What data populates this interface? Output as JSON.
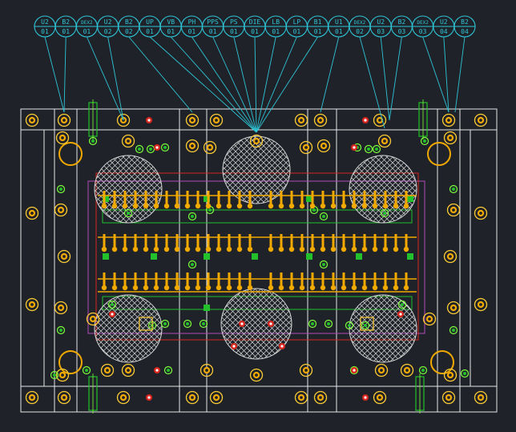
{
  "cad": {
    "background_color": "#1f2329",
    "colors": {
      "outline": "#e6e6e6",
      "leader": "#2ec4d6",
      "balloon_text": "#2ec4d6",
      "copper": "#f2a900",
      "copper_ring": "#ffcc33",
      "green_part": "#22c02a",
      "green_ring": "#7cff3a",
      "red_part": "#d8261e",
      "purple_line": "#b04ab8",
      "hatch": "#d6d6d6"
    },
    "balloons": [
      {
        "top": "U2",
        "bottom": "01"
      },
      {
        "top": "B2",
        "bottom": "01"
      },
      {
        "top": "DEX2",
        "bottom": "01"
      },
      {
        "top": "U2",
        "bottom": "02"
      },
      {
        "top": "B2",
        "bottom": "02"
      },
      {
        "top": "UP",
        "bottom": "01"
      },
      {
        "top": "VB",
        "bottom": "01"
      },
      {
        "top": "PH",
        "bottom": "01"
      },
      {
        "top": "PPS",
        "bottom": "01"
      },
      {
        "top": "PS",
        "bottom": "01"
      },
      {
        "top": "DIE",
        "bottom": "01"
      },
      {
        "top": "LB",
        "bottom": "01"
      },
      {
        "top": "LP",
        "bottom": "01"
      },
      {
        "top": "B1",
        "bottom": "01"
      },
      {
        "top": "U1",
        "bottom": "01"
      },
      {
        "top": "DEX2",
        "bottom": "02"
      },
      {
        "top": "U2",
        "bottom": "03"
      },
      {
        "top": "B2",
        "bottom": "03"
      },
      {
        "top": "DEX2",
        "bottom": "03"
      },
      {
        "top": "U2",
        "bottom": "04"
      },
      {
        "top": "B2",
        "bottom": "04"
      }
    ]
  }
}
